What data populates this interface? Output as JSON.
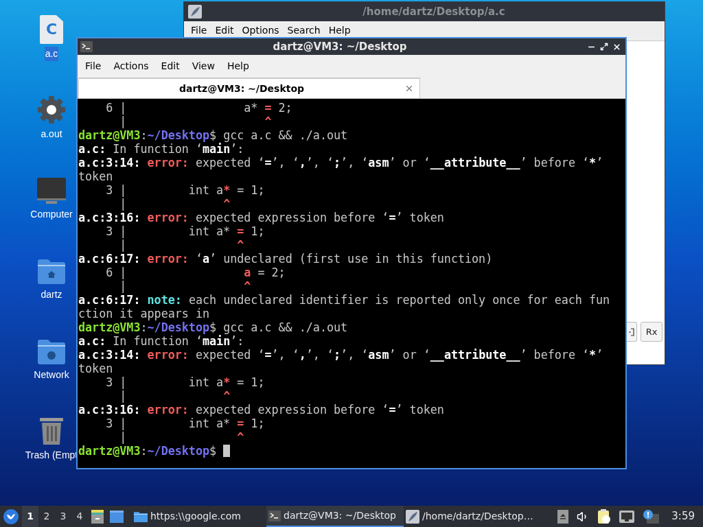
{
  "desktop_icons": [
    {
      "label": "a.c",
      "kind": "c_file",
      "glyph": "C",
      "selected": true
    },
    {
      "label": "a.out",
      "kind": "executable",
      "selected": false
    },
    {
      "label": "Computer",
      "kind": "computer",
      "selected": false
    },
    {
      "label": "dartz",
      "kind": "home",
      "selected": false
    },
    {
      "label": "Network",
      "kind": "network",
      "selected": false
    },
    {
      "label": "Trash (Empt",
      "kind": "trash",
      "selected": false
    }
  ],
  "editor_window": {
    "title": "/home/dartz/Desktop/a.c",
    "menu": [
      "File",
      "Edit",
      "Options",
      "Search",
      "Help"
    ],
    "toolbar_label": "Rx"
  },
  "terminal_window": {
    "title": "dartz@VM3: ~/Desktop",
    "menu": [
      "File",
      "Actions",
      "Edit",
      "View",
      "Help"
    ],
    "tabs": [
      {
        "label": "dartz@VM3: ~/Desktop",
        "selected": true
      }
    ],
    "cursor_visible": true,
    "lines": [
      [
        {
          "t": "    6 |                 a* ",
          "kind": "plain"
        },
        {
          "t": "=",
          "kind": "caret"
        },
        {
          "t": " 2;",
          "kind": "plain"
        }
      ],
      [
        {
          "t": "      |                    ",
          "kind": "plain"
        },
        {
          "t": "^",
          "kind": "caret"
        }
      ],
      [
        {
          "t": "dartz@VM3",
          "kind": "user"
        },
        {
          "t": ":",
          "kind": "plain"
        },
        {
          "t": "~/Desktop",
          "kind": "path"
        },
        {
          "t": "$ gcc a.c && ./a.out",
          "kind": "plain"
        }
      ],
      [
        {
          "t": "a.c:",
          "kind": "bold"
        },
        {
          "t": " In function ‘",
          "kind": "plain"
        },
        {
          "t": "main",
          "kind": "bold"
        },
        {
          "t": "’:",
          "kind": "plain"
        }
      ],
      [
        {
          "t": "a.c:3:14: ",
          "kind": "bold"
        },
        {
          "t": "error:",
          "kind": "error"
        },
        {
          "t": " expected ‘",
          "kind": "plain"
        },
        {
          "t": "=",
          "kind": "bold"
        },
        {
          "t": "’, ‘",
          "kind": "plain"
        },
        {
          "t": ",",
          "kind": "bold"
        },
        {
          "t": "’, ‘",
          "kind": "plain"
        },
        {
          "t": ";",
          "kind": "bold"
        },
        {
          "t": "’, ‘",
          "kind": "plain"
        },
        {
          "t": "asm",
          "kind": "bold"
        },
        {
          "t": "’ or ‘",
          "kind": "plain"
        },
        {
          "t": "__attribute__",
          "kind": "bold"
        },
        {
          "t": "’ before ‘",
          "kind": "plain"
        },
        {
          "t": "*",
          "kind": "bold"
        },
        {
          "t": "’",
          "kind": "plain"
        }
      ],
      [
        {
          "t": "token",
          "kind": "plain"
        }
      ],
      [
        {
          "t": "    3 |         int a",
          "kind": "plain"
        },
        {
          "t": "*",
          "kind": "caret"
        },
        {
          "t": " = 1;",
          "kind": "plain"
        }
      ],
      [
        {
          "t": "      |              ",
          "kind": "plain"
        },
        {
          "t": "^",
          "kind": "caret"
        }
      ],
      [
        {
          "t": "a.c:3:16: ",
          "kind": "bold"
        },
        {
          "t": "error:",
          "kind": "error"
        },
        {
          "t": " expected expression before ‘",
          "kind": "plain"
        },
        {
          "t": "=",
          "kind": "bold"
        },
        {
          "t": "’ token",
          "kind": "plain"
        }
      ],
      [
        {
          "t": "    3 |         int a* ",
          "kind": "plain"
        },
        {
          "t": "=",
          "kind": "caret"
        },
        {
          "t": " 1;",
          "kind": "plain"
        }
      ],
      [
        {
          "t": "      |                ",
          "kind": "plain"
        },
        {
          "t": "^",
          "kind": "caret"
        }
      ],
      [
        {
          "t": "a.c:6:17: ",
          "kind": "bold"
        },
        {
          "t": "error:",
          "kind": "error"
        },
        {
          "t": " ‘",
          "kind": "plain"
        },
        {
          "t": "a",
          "kind": "bold"
        },
        {
          "t": "’ undeclared (first use in this function)",
          "kind": "plain"
        }
      ],
      [
        {
          "t": "    6 |                 ",
          "kind": "plain"
        },
        {
          "t": "a",
          "kind": "caret"
        },
        {
          "t": " = 2;",
          "kind": "plain"
        }
      ],
      [
        {
          "t": "      |                 ",
          "kind": "plain"
        },
        {
          "t": "^",
          "kind": "caret"
        }
      ],
      [
        {
          "t": "a.c:6:17: ",
          "kind": "bold"
        },
        {
          "t": "note:",
          "kind": "note"
        },
        {
          "t": " each undeclared identifier is reported only once for each fun",
          "kind": "plain"
        }
      ],
      [
        {
          "t": "ction it appears in",
          "kind": "plain"
        }
      ],
      [
        {
          "t": "dartz@VM3",
          "kind": "user"
        },
        {
          "t": ":",
          "kind": "plain"
        },
        {
          "t": "~/Desktop",
          "kind": "path"
        },
        {
          "t": "$ gcc a.c && ./a.out",
          "kind": "plain"
        }
      ],
      [
        {
          "t": "a.c:",
          "kind": "bold"
        },
        {
          "t": " In function ‘",
          "kind": "plain"
        },
        {
          "t": "main",
          "kind": "bold"
        },
        {
          "t": "’:",
          "kind": "plain"
        }
      ],
      [
        {
          "t": "a.c:3:14: ",
          "kind": "bold"
        },
        {
          "t": "error:",
          "kind": "error"
        },
        {
          "t": " expected ‘",
          "kind": "plain"
        },
        {
          "t": "=",
          "kind": "bold"
        },
        {
          "t": "’, ‘",
          "kind": "plain"
        },
        {
          "t": ",",
          "kind": "bold"
        },
        {
          "t": "’, ‘",
          "kind": "plain"
        },
        {
          "t": ";",
          "kind": "bold"
        },
        {
          "t": "’, ‘",
          "kind": "plain"
        },
        {
          "t": "asm",
          "kind": "bold"
        },
        {
          "t": "’ or ‘",
          "kind": "plain"
        },
        {
          "t": "__attribute__",
          "kind": "bold"
        },
        {
          "t": "’ before ‘",
          "kind": "plain"
        },
        {
          "t": "*",
          "kind": "bold"
        },
        {
          "t": "’",
          "kind": "plain"
        }
      ],
      [
        {
          "t": "token",
          "kind": "plain"
        }
      ],
      [
        {
          "t": "    3 |         int a",
          "kind": "plain"
        },
        {
          "t": "*",
          "kind": "caret"
        },
        {
          "t": " = 1;",
          "kind": "plain"
        }
      ],
      [
        {
          "t": "      |              ",
          "kind": "plain"
        },
        {
          "t": "^",
          "kind": "caret"
        }
      ],
      [
        {
          "t": "a.c:3:16: ",
          "kind": "bold"
        },
        {
          "t": "error:",
          "kind": "error"
        },
        {
          "t": " expected expression before ‘",
          "kind": "plain"
        },
        {
          "t": "=",
          "kind": "bold"
        },
        {
          "t": "’ token",
          "kind": "plain"
        }
      ],
      [
        {
          "t": "    3 |         int a* ",
          "kind": "plain"
        },
        {
          "t": "=",
          "kind": "caret"
        },
        {
          "t": " 1;",
          "kind": "plain"
        }
      ],
      [
        {
          "t": "      |                ",
          "kind": "plain"
        },
        {
          "t": "^",
          "kind": "caret"
        }
      ],
      [
        {
          "t": "dartz@VM3",
          "kind": "user"
        },
        {
          "t": ":",
          "kind": "plain"
        },
        {
          "t": "~/Desktop",
          "kind": "path"
        },
        {
          "t": "$",
          "kind": "plain"
        }
      ]
    ]
  },
  "taskbar": {
    "workspaces": [
      {
        "label": "1",
        "selected": true
      },
      {
        "label": "2",
        "selected": false
      },
      {
        "label": "3",
        "selected": false
      },
      {
        "label": "4",
        "selected": false
      }
    ],
    "tasks": [
      {
        "label": "https:\\\\google.com",
        "kind": "folder",
        "selected": false
      },
      {
        "label": "dartz@VM3: ~/Desktop",
        "kind": "terminal",
        "selected": true
      },
      {
        "label": "/home/dartz/Desktop…",
        "kind": "editor",
        "selected": false
      }
    ],
    "clock": "3:59"
  }
}
